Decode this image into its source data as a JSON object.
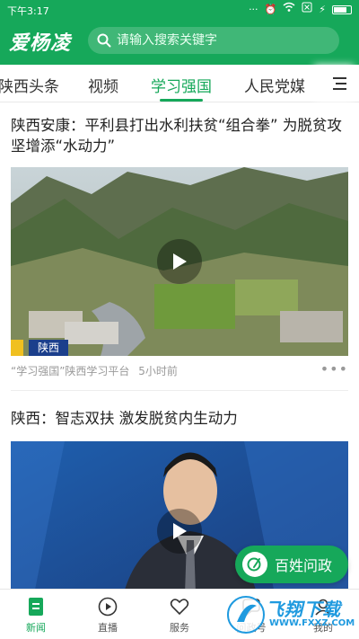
{
  "status_bar": {
    "time": "下午3:17"
  },
  "header": {
    "logo_text": "爱杨凌",
    "search": {
      "placeholder": "请输入搜索关键字"
    },
    "accent_color": "#16a85a"
  },
  "tabs": {
    "items": [
      {
        "label": "陕西头条"
      },
      {
        "label": "视频"
      },
      {
        "label": "学习强国"
      },
      {
        "label": "人民党媒"
      }
    ],
    "active_index": 2
  },
  "feed": {
    "articles": [
      {
        "title": "陕西安康：平利县打出水利扶贫“组合拳” 为脱贫攻坚增添“水动力”",
        "image_caption": "陕西",
        "source": "“学习强国”陕西学习平台",
        "time": "5小时前",
        "has_video": true
      },
      {
        "title": "陕西：智志双扶 激发脱贫内生动力",
        "has_video": true
      }
    ]
  },
  "float_button": {
    "label": "百姓问政"
  },
  "bottom_nav": {
    "items": [
      {
        "label": "新闻",
        "icon": "news-icon"
      },
      {
        "label": "直播",
        "icon": "play-icon"
      },
      {
        "label": "服务",
        "icon": "heart-icon"
      },
      {
        "label": "问政号",
        "icon": "message-icon"
      },
      {
        "label": "我的",
        "icon": "user-icon"
      }
    ],
    "active_index": 0
  },
  "watermark": {
    "text": "飞翔下载",
    "url": "WWW.FXXZ.COM"
  }
}
